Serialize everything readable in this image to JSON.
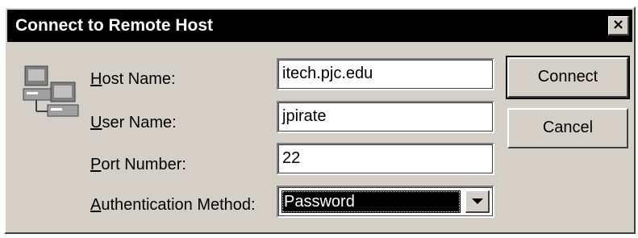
{
  "dialog": {
    "title": "Connect to Remote Host",
    "close_glyph": "×"
  },
  "icons": {
    "host": "networked-computers-icon",
    "close": "close-icon",
    "dropdown": "chevron-down-icon"
  },
  "form": {
    "host_name": {
      "label_mnemonic": "H",
      "label_rest": "ost Name:",
      "value": "itech.pjc.edu"
    },
    "user_name": {
      "label_mnemonic": "U",
      "label_rest": "ser Name:",
      "value": "jpirate"
    },
    "port_number": {
      "label_mnemonic": "P",
      "label_rest": "ort Number:",
      "value": "22"
    },
    "auth_method": {
      "label_mnemonic": "A",
      "label_rest": "uthentication Method:",
      "selected": "Password"
    }
  },
  "buttons": {
    "connect": "Connect",
    "cancel": "Cancel"
  },
  "colors": {
    "dialog_face": "#d4d0c8",
    "titlebar": "#000000",
    "selection": "#000000"
  }
}
